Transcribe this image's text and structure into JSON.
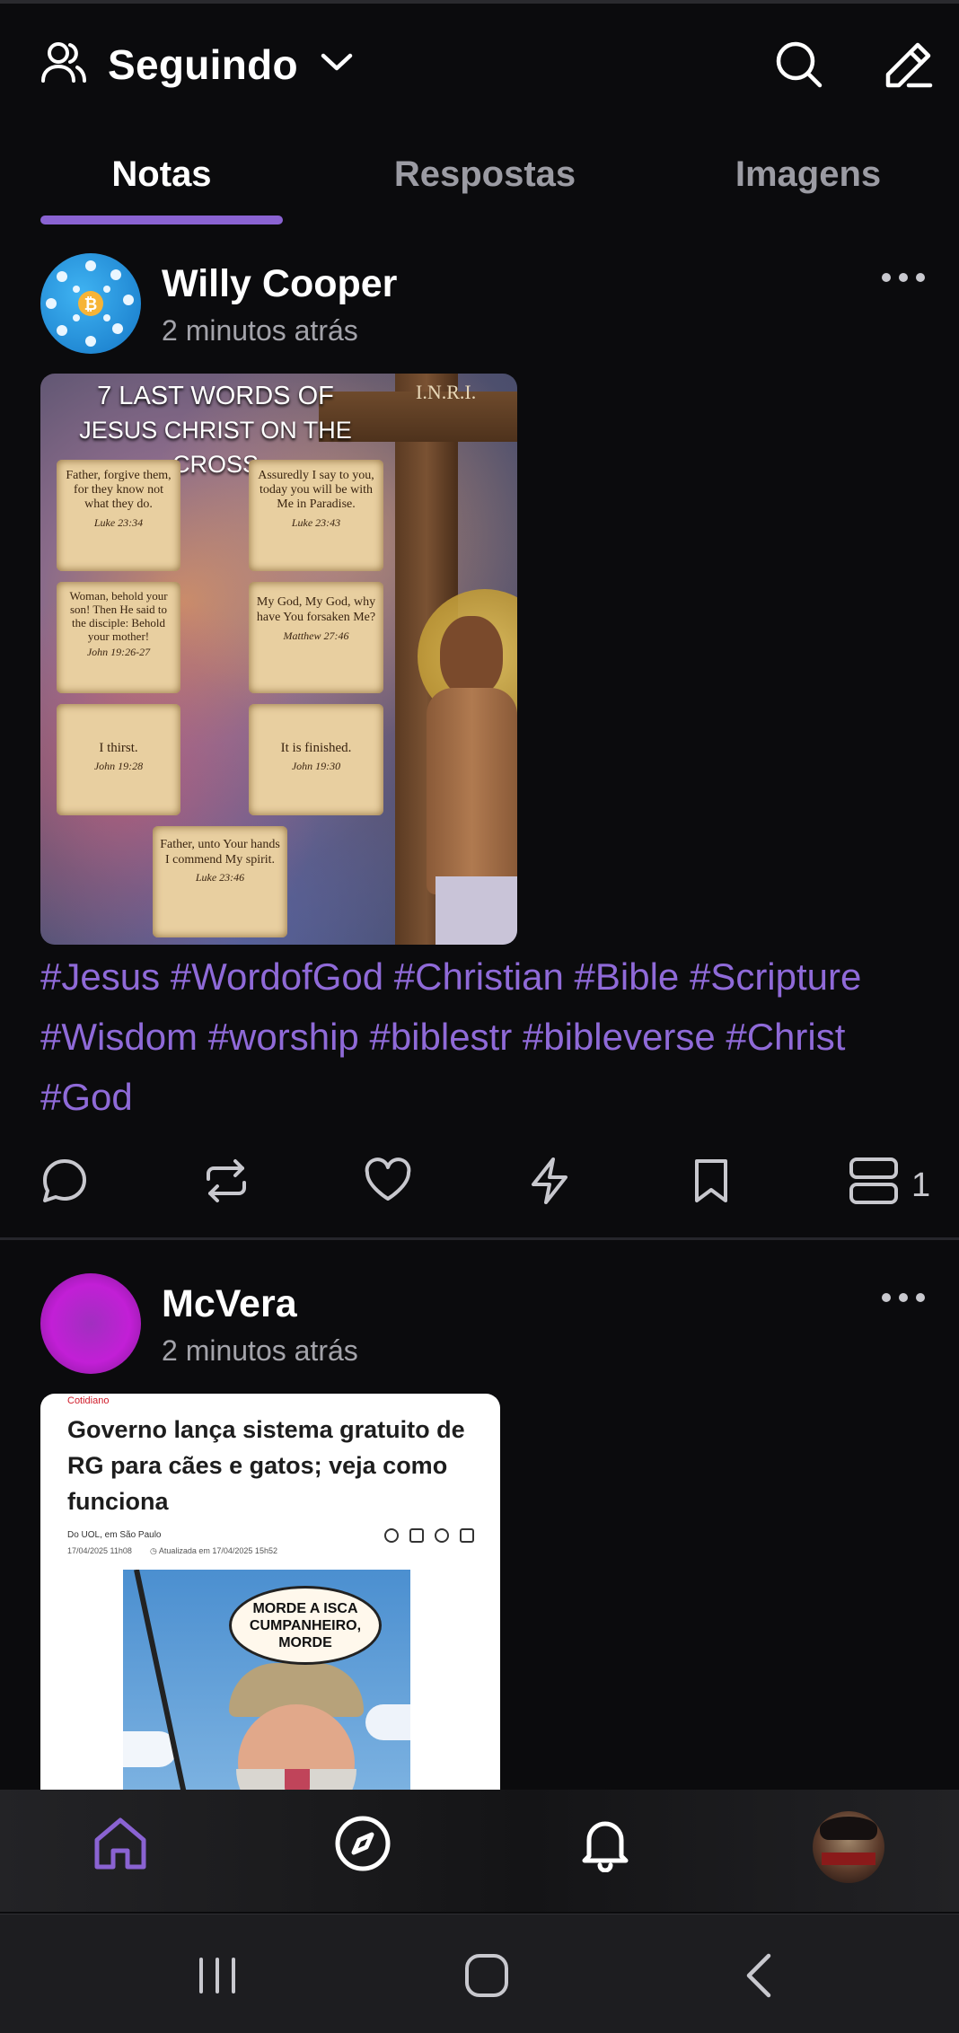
{
  "header": {
    "title": "Seguindo",
    "icons": [
      "users-icon",
      "chevron-down-icon",
      "search-icon",
      "compose-icon"
    ]
  },
  "tabs": [
    {
      "label": "Notas",
      "active": true
    },
    {
      "label": "Respostas",
      "active": false
    },
    {
      "label": "Imagens",
      "active": false
    }
  ],
  "posts": [
    {
      "author": "Willy Cooper",
      "time": "2 minutos atrás",
      "image": {
        "title_line1": "7 LAST WORDS OF",
        "title_line2": "JESUS CHRIST ON THE CROSS",
        "inri": "I.N.R.I.",
        "scrolls": [
          {
            "text": "Father, forgive them, for they know not what they do.",
            "ref": "Luke 23:34"
          },
          {
            "text": "Assuredly I say to you, today you will be with Me in Paradise.",
            "ref": "Luke 23:43"
          },
          {
            "text": "Woman, behold your son! Then He said to the disciple: Behold your mother!",
            "ref": "John 19:26-27"
          },
          {
            "text": "My God, My God, why have You forsaken Me?",
            "ref": "Matthew 27:46"
          },
          {
            "text": "I thirst.",
            "ref": "John 19:28"
          },
          {
            "text": "It is finished.",
            "ref": "John 19:30"
          },
          {
            "text": "Father, unto Your hands I commend My spirit.",
            "ref": "Luke 23:46"
          }
        ]
      },
      "hashtags": "#Jesus #WordofGod #Christian #Bible #Scripture #Wisdom #worship #biblestr #bibleverse #Christ #God",
      "actions": {
        "reply_count": "1"
      }
    },
    {
      "author": "McVera",
      "time": "2 minutos atrás",
      "article": {
        "section": "Cotidiano",
        "headline": "Governo lança sistema gratuito de RG para cães e gatos; veja como funciona",
        "byline": "Do UOL, em São Paulo",
        "date": "17/04/2025 11h08",
        "updated": "Atualizada em 17/04/2025 15h52",
        "bubble": "MORDE A ISCA CUMPANHEIRO, MORDE"
      }
    }
  ],
  "bottom_nav": [
    "home-icon",
    "compass-icon",
    "bell-icon",
    "profile-avatar"
  ],
  "colors": {
    "accent": "#8a63d2",
    "hashtag": "#8f6ad8",
    "background": "#0b0b0d"
  }
}
